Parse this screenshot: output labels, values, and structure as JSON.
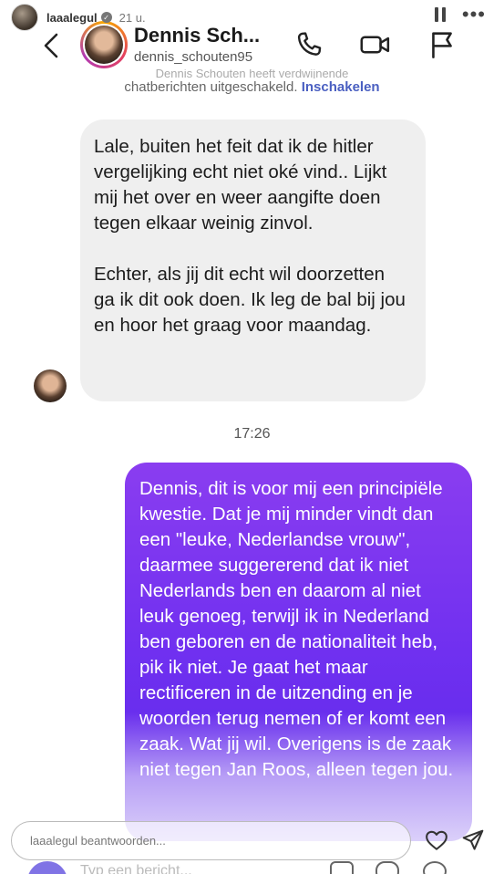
{
  "story": {
    "username": "laaalegul",
    "time": "21 u."
  },
  "chat": {
    "contact_name": "Dennis Sch...",
    "contact_handle": "dennis_schouten95",
    "notice_line1": "Dennis Schouten heeft verdwijnende",
    "notice_line2": "chatberichten uitgeschakeld.",
    "notice_action": "Inschakelen",
    "incoming_para1": "Lale, buiten het feit dat ik de hitler vergelijking echt niet oké vind.. Lijkt mij het over en weer aangifte doen tegen elkaar weinig zinvol.",
    "incoming_para2": "Echter, als jij dit echt wil doorzetten ga ik dit ook doen. Ik leg de bal bij jou en hoor het graag voor maandag.",
    "timestamp": "17:26",
    "outgoing_text": "Dennis, dit is voor mij een principiële kwestie. Dat je mij minder vindt dan een \"leuke, Nederlandse vrouw\", daarmee suggererend dat ik niet Nederlands ben en daarom al niet leuk genoeg, terwijl ik in Nederland ben geboren en de nationaliteit heb, pik ik niet. Je gaat het maar rectificeren in de uitzending en je woorden terug nemen of er komt een zaak. Wat jij wil. Overigens is de zaak niet tegen Jan Roos, alleen tegen jou."
  },
  "reply": {
    "placeholder": "laaalegul beantwoorden..."
  },
  "composer_peek": {
    "text": "Typ een bericht..."
  },
  "colors": {
    "outgoing_bubble": "#7030f0",
    "incoming_bubble": "#efefef",
    "link": "#4a5fc1"
  }
}
